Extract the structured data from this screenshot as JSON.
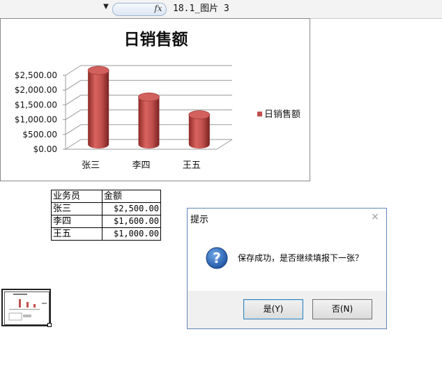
{
  "formula_bar": {
    "fx_label": "fx",
    "value": "18.1_图片 3"
  },
  "chart": {
    "title": "日销售额",
    "legend": "日销售额"
  },
  "chart_data": {
    "type": "bar",
    "title": "日销售额",
    "categories": [
      "张三",
      "李四",
      "王五"
    ],
    "series": [
      {
        "name": "日销售额",
        "values": [
          2500,
          1600,
          1000
        ]
      }
    ],
    "y_ticks": [
      "$0.00",
      "$500.00",
      "$1,000.00",
      "$1,500.00",
      "$2,000.00",
      "$2,500.00"
    ],
    "ylim": [
      0,
      2500
    ],
    "legend_position": "right",
    "grid": true,
    "colors": {
      "bar": "#c0504d"
    }
  },
  "table": {
    "headers": [
      "业务员",
      "金额"
    ],
    "rows": [
      [
        "张三",
        "$2,500.00"
      ],
      [
        "李四",
        "$1,600.00"
      ],
      [
        "王五",
        "$1,000.00"
      ]
    ]
  },
  "dialog": {
    "title": "提示",
    "close": "×",
    "message": "保存成功，是否继续填报下一张？",
    "icon": "question-icon",
    "yes_label": "是(Y)",
    "no_label": "否(N)"
  }
}
